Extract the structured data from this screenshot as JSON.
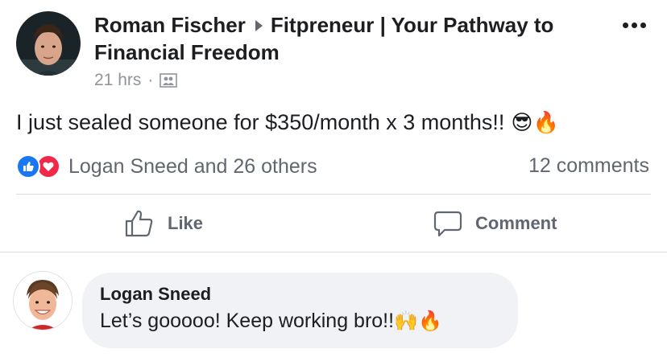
{
  "post": {
    "author": "Roman Fischer",
    "group": "Fitpreneur | Your Pathway to",
    "group_cont": "Financial Freedom",
    "time": "21 hrs",
    "dot": "·",
    "text": "I just sealed someone for $350/month x 3 months!!",
    "emojis": "😎🔥",
    "icons": {
      "more": "more-dots-icon",
      "audience": "group-audience-icon"
    }
  },
  "reactions": {
    "names": "Logan Sneed and 26 others",
    "icons": [
      "like-reaction-icon",
      "love-reaction-icon"
    ],
    "comments_count": "12 comments",
    "colors": {
      "like": "#1877f2",
      "love": "#f0284a"
    }
  },
  "actions": {
    "like_label": "Like",
    "comment_label": "Comment"
  },
  "comment": {
    "author": "Logan Sneed",
    "text": "Let’s gooooo! Keep working bro!!",
    "emojis": "🙌🔥"
  }
}
